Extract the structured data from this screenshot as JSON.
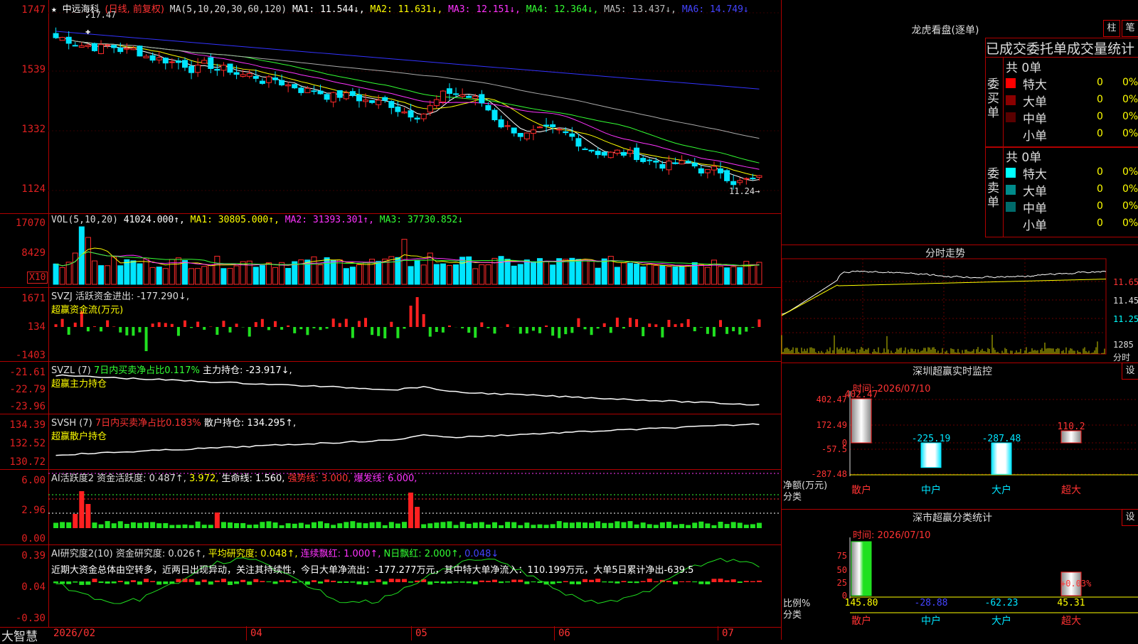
{
  "colors": {
    "up": "#ff2a2a",
    "down": "#00e5ff",
    "ma1": "#ffffff",
    "ma2": "#ffff00",
    "ma3": "#ff33ff",
    "ma4": "#33ff33",
    "ma5": "#aaaaaa",
    "ma6": "#3333ff",
    "border": "#b00000"
  },
  "kline": {
    "star": "★",
    "name": "中远海科",
    "mode": "(日线, 前复权)",
    "ma_label": "MA(5,10,20,30,60,120)",
    "ma1": "MA1: 11.544↓,",
    "ma2": "MA2: 11.631↓,",
    "ma3": "MA3: 12.151↓,",
    "ma4": "MA4: 12.364↓,",
    "ma5": "MA5: 13.437↓,",
    "ma6": "MA6: 14.749↓",
    "axis": [
      "1747",
      "1539",
      "1332",
      "1124"
    ],
    "hi_label": "17.47",
    "lo_label": "11.24"
  },
  "vol": {
    "label": "VOL(5,10,20)",
    "value": "41024.000↑,",
    "ma1": "MA1: 30805.000↑,",
    "ma2": "MA2: 31393.301↑,",
    "ma3": "MA3: 37730.852↓",
    "axis": [
      "17070",
      "8429"
    ],
    "unit": "X10"
  },
  "svzj": {
    "label": "SVZJ  活跃资金进出: -177.290↓,",
    "sub": "超赢资金流(万元)",
    "axis": [
      "1671",
      "134",
      "-1403"
    ]
  },
  "svzl": {
    "label": "SVZL (7)",
    "pct": "7日内买卖净占比0.117%",
    "main": "主力持仓: -23.917↓,",
    "sub": "超赢主力持仓",
    "axis": [
      "-21.61",
      "-22.79",
      "-23.96"
    ]
  },
  "svsh": {
    "label": "SVSH (7)",
    "pct": "7日内买卖净占比0.183%",
    "main": "散户持仓: 134.295↑,",
    "sub": "超赢散户持仓",
    "axis": [
      "134.39",
      "132.52",
      "130.72"
    ]
  },
  "ai1": {
    "label": "AI活跃度2 资金活跃度: 0.487↑,",
    "v2": "3.972,",
    "life": "生命线: 1.560,",
    "strong": "强势线: 3.000,",
    "burst": "爆发线: 6.000,",
    "axis": [
      "6.00",
      "2.96",
      "0.00"
    ]
  },
  "ai2": {
    "label": "AI研究度2(10) 资金研究度: 0.026↑,",
    "avg": "平均研究度: 0.048↑,",
    "cont": "连续飘红: 1.000↑,",
    "nday": "N日飘红: 2.000↑,",
    "last": "0.048↓",
    "comment": "近期大资金总体由空转多，近两日出现异动，关注其持续性，今日大单净流出：-177.277万元，其中特大单净流入：110.199万元，大单5日累计净出-639.5",
    "axis": [
      "0.39",
      "0.04",
      "-0.30"
    ]
  },
  "footer": {
    "brand": "大智慧",
    "dates": [
      "2026/02",
      "04",
      "05",
      "06",
      "07"
    ]
  },
  "lhb": {
    "title": "龙虎看盘(逐单)",
    "btn_zhu": "柱",
    "btn_bi": "笔",
    "header": "已成交委托单成交量统计",
    "buy_label": "委买单",
    "sell_label": "委卖单",
    "buy_total": "共 0单",
    "sell_total": "共 0单",
    "buy_rows": [
      {
        "name": "特大",
        "n": "0",
        "p": "0%",
        "color": "#ff0000"
      },
      {
        "name": "大单",
        "n": "0",
        "p": "0%",
        "color": "#8b0000"
      },
      {
        "name": "中单",
        "n": "0",
        "p": "0%",
        "color": "#5a0000"
      },
      {
        "name": "小单",
        "n": "0",
        "p": "0%",
        "color": "#000000"
      }
    ],
    "sell_rows": [
      {
        "name": "特大",
        "n": "0",
        "p": "0%",
        "color": "#00ffff"
      },
      {
        "name": "大单",
        "n": "0",
        "p": "0%",
        "color": "#008b8b"
      },
      {
        "name": "中单",
        "n": "0",
        "p": "0%",
        "color": "#006b6b"
      },
      {
        "name": "小单",
        "n": "0",
        "p": "0%",
        "color": "#000000"
      }
    ]
  },
  "intraday": {
    "title": "分时走势",
    "axis": [
      "11.65",
      "11.45",
      "11.25"
    ],
    "vol_axis": "1285",
    "vol_unit": "分时"
  },
  "monitor": {
    "title": "深圳超赢实时监控",
    "btn": "设",
    "time": "时间: 2026/07/10",
    "axis": [
      "402.47",
      "172.49",
      "0",
      "-57.5",
      "-287.48"
    ],
    "bars": [
      {
        "name": "散户",
        "value": 402.47,
        "label": "402.47"
      },
      {
        "name": "中户",
        "value": -225.19,
        "label": "-225.19"
      },
      {
        "name": "大户",
        "value": -287.48,
        "label": "-287.48"
      },
      {
        "name": "超大",
        "value": 110.2,
        "label": "110.2"
      }
    ],
    "ylabel": "净额(万元)",
    "xlabel": "分类"
  },
  "classify": {
    "title": "深市超赢分类统计",
    "btn": "设",
    "time": "时间: 2026/07/10",
    "axis": [
      "75",
      "50",
      "25",
      "0"
    ],
    "pct_label": "+0.03%",
    "bars": [
      {
        "name": "散户",
        "value": 145.8,
        "label": "145.80"
      },
      {
        "name": "中户",
        "value": -28.88,
        "label": "-28.88"
      },
      {
        "name": "大户",
        "value": -62.23,
        "label": "-62.23"
      },
      {
        "name": "超大",
        "value": 45.31,
        "label": "45.31"
      }
    ],
    "ylabel": "比例%",
    "xlabel": "分类"
  }
}
